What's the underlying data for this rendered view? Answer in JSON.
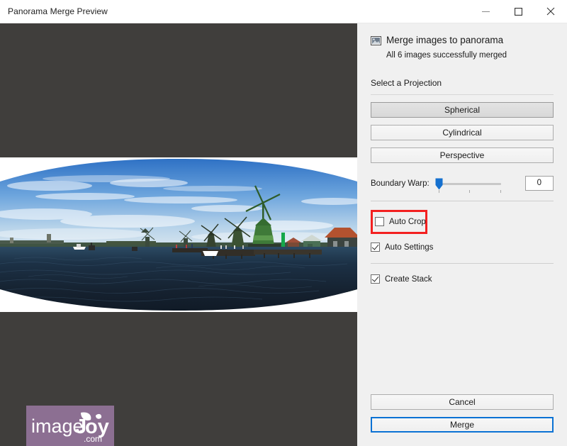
{
  "window": {
    "title": "Panorama Merge Preview",
    "controls": {
      "minimize": "minimize-icon",
      "maximize": "maximize-icon",
      "close": "close-icon"
    }
  },
  "preview": {
    "background_color": "#403e3c",
    "canvas_color": "#ffffff",
    "watermark": {
      "text_image": "image",
      "text_joy": "J",
      "text_oy": "oy",
      "domain": "com",
      "dot": ".",
      "background_color": "#8c6f92"
    },
    "image_description": "Panoramic photo of Dutch windmills at Zaanse Schans beside a river, with curved white borders from spherical projection"
  },
  "panel": {
    "header": {
      "icon": "picture-icon",
      "title": "Merge images to panorama",
      "subtitle": "All 6 images successfully merged"
    },
    "projection": {
      "label": "Select a Projection",
      "options": [
        {
          "label": "Spherical",
          "selected": true
        },
        {
          "label": "Cylindrical",
          "selected": false
        },
        {
          "label": "Perspective",
          "selected": false
        }
      ]
    },
    "boundary_warp": {
      "label": "Boundary Warp:",
      "value": "0",
      "min": 0,
      "max": 100,
      "accent_color": "#1570cf"
    },
    "checkboxes": [
      {
        "label": "Auto Crop",
        "checked": false,
        "highlighted": true,
        "highlight_color": "#f32020"
      },
      {
        "label": "Auto Settings",
        "checked": true,
        "highlighted": false
      },
      {
        "label": "Create Stack",
        "checked": true,
        "highlighted": false
      }
    ],
    "footer": {
      "cancel_label": "Cancel",
      "merge_label": "Merge",
      "merge_focus_color": "#0a72d4"
    }
  }
}
